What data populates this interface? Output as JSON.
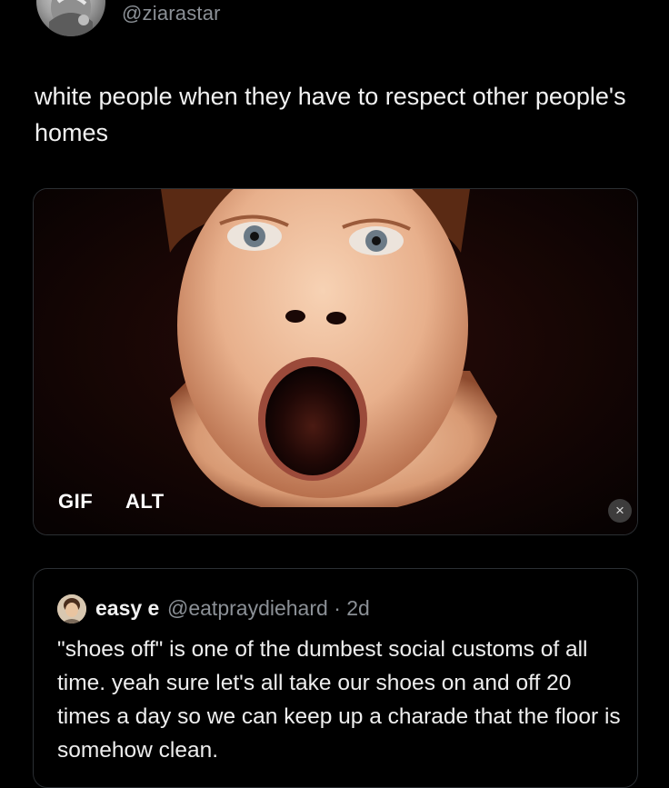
{
  "tweet": {
    "handle": "@ziarastar",
    "text": "white people when they have to respect other people's homes"
  },
  "media": {
    "gif_badge": "GIF",
    "alt_badge": "ALT",
    "close_icon": "×"
  },
  "quote": {
    "name": "easy e",
    "handle": "@eatpraydiehard",
    "separator": "·",
    "time": "2d",
    "text": "\"shoes off\" is one of the dumbest social customs of all time. yeah sure let's all take our shoes on and off 20 times a day so we can keep up a charade that the floor is somehow clean."
  },
  "colors": {
    "background": "#000000",
    "text_primary": "#e7e9ea",
    "text_secondary": "#8b9096",
    "border": "#2b2f33"
  }
}
